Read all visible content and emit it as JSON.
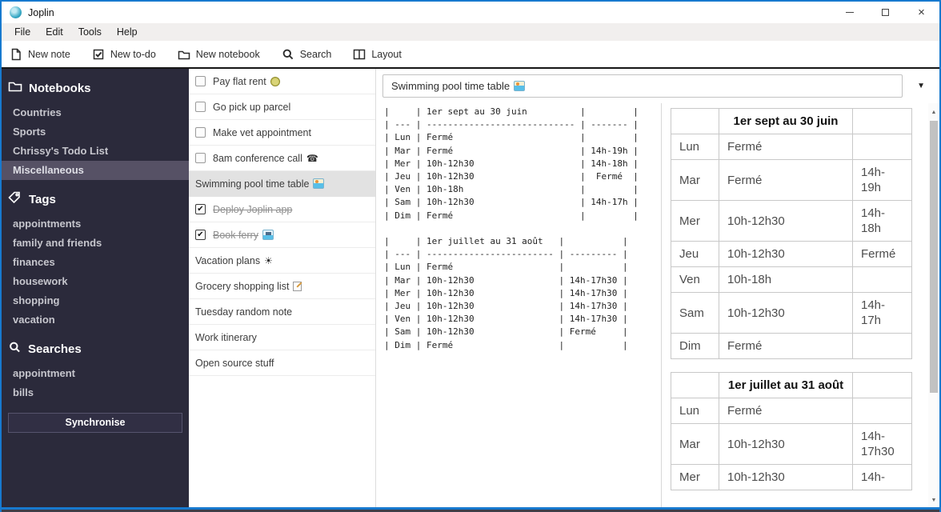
{
  "window": {
    "title": "Joplin",
    "controls": {
      "minimize": "minimize",
      "maximize": "maximize",
      "close": "close"
    }
  },
  "menu_bar": {
    "items": [
      "File",
      "Edit",
      "Tools",
      "Help"
    ]
  },
  "toolbar": {
    "items": [
      {
        "label": "New note",
        "icon": "new-note-icon"
      },
      {
        "label": "New to-do",
        "icon": "new-todo-icon"
      },
      {
        "label": "New notebook",
        "icon": "new-notebook-icon"
      },
      {
        "label": "Search",
        "icon": "search-icon"
      },
      {
        "label": "Layout",
        "icon": "layout-icon"
      }
    ]
  },
  "sidebar": {
    "notebooks": {
      "header": "Notebooks",
      "icon": "notebook-folder-icon",
      "items": [
        {
          "label": "Countries",
          "selected": false
        },
        {
          "label": "Sports",
          "selected": false
        },
        {
          "label": "Chrissy's Todo List",
          "selected": false
        },
        {
          "label": "Miscellaneous",
          "selected": true
        }
      ]
    },
    "tags": {
      "header": "Tags",
      "icon": "tag-icon",
      "items": [
        "appointments",
        "family and friends",
        "finances",
        "housework",
        "shopping",
        "vacation"
      ]
    },
    "searches": {
      "header": "Searches",
      "icon": "search-icon",
      "items": [
        "appointment",
        "bills"
      ]
    },
    "sync_button_label": "Synchronise"
  },
  "note_list": {
    "items": [
      {
        "title": "Pay flat rent",
        "emoji": "money-bag",
        "todo": true,
        "checked": false,
        "selected": false
      },
      {
        "title": "Go pick up parcel",
        "todo": true,
        "checked": false,
        "selected": false
      },
      {
        "title": "Make vet appointment",
        "todo": true,
        "checked": false,
        "selected": false
      },
      {
        "title": "8am conference call",
        "emoji": "phone",
        "todo": true,
        "checked": false,
        "selected": false
      },
      {
        "title": "Swimming pool time table",
        "emoji": "swimmer",
        "todo": false,
        "checked": false,
        "selected": true
      },
      {
        "title": "Deploy Joplin app",
        "todo": true,
        "checked": true,
        "selected": false
      },
      {
        "title": "Book ferry",
        "emoji": "ferry",
        "todo": true,
        "checked": true,
        "selected": false
      },
      {
        "title": "Vacation plans",
        "emoji": "sun",
        "todo": false,
        "checked": false,
        "selected": false
      },
      {
        "title": "Grocery shopping list",
        "emoji": "memo",
        "todo": false,
        "checked": false,
        "selected": false
      },
      {
        "title": "Tuesday random note",
        "todo": false,
        "checked": false,
        "selected": false
      },
      {
        "title": "Work itinerary",
        "todo": false,
        "checked": false,
        "selected": false
      },
      {
        "title": "Open source stuff",
        "todo": false,
        "checked": false,
        "selected": false
      }
    ]
  },
  "editor": {
    "note_title": "Swimming pool time table",
    "note_title_emoji": "swimmer",
    "dropdown_arrow": "▼",
    "lines": [
      "|     | 1er sept au 30 juin          |         |",
      "| --- | ---------------------------- | ------- |",
      "| Lun | Fermé                        |         |",
      "| Mar | Fermé                        | 14h-19h |",
      "| Mer | 10h-12h30                    | 14h-18h |",
      "| Jeu | 10h-12h30                    |  Fermé  |",
      "| Ven | 10h-18h                      |         |",
      "| Sam | 10h-12h30                    | 14h-17h |",
      "| Dim | Fermé                        |         |",
      "",
      "|     | 1er juillet au 31 août   |           |",
      "| --- | ------------------------ | --------- |",
      "| Lun | Fermé                    |           |",
      "| Mar | 10h-12h30                | 14h-17h30 |",
      "| Mer | 10h-12h30                | 14h-17h30 |",
      "| Jeu | 10h-12h30                | 14h-17h30 |",
      "| Ven | 10h-12h30                | 14h-17h30 |",
      "| Sam | 10h-12h30                | Fermé     |",
      "| Dim | Fermé                    |           |"
    ]
  },
  "viewer": {
    "tables": [
      {
        "header": [
          "",
          "1er sept au 30 juin",
          ""
        ],
        "rows": [
          [
            "Lun",
            "Fermé",
            ""
          ],
          [
            "Mar",
            "Fermé",
            "14h-19h"
          ],
          [
            "Mer",
            "10h-12h30",
            "14h-18h"
          ],
          [
            "Jeu",
            "10h-12h30",
            "Fermé"
          ],
          [
            "Ven",
            "10h-18h",
            ""
          ],
          [
            "Sam",
            "10h-12h30",
            "14h-17h"
          ],
          [
            "Dim",
            "Fermé",
            ""
          ]
        ]
      },
      {
        "header": [
          "",
          "1er juillet au 31 août",
          ""
        ],
        "rows": [
          [
            "Lun",
            "Fermé",
            ""
          ],
          [
            "Mar",
            "10h-12h30",
            "14h-17h30"
          ],
          [
            "Mer",
            "10h-12h30",
            "14h-"
          ]
        ]
      }
    ]
  },
  "colors": {
    "sidebar_bg": "#2b2a3b",
    "sidebar_selected_bg": "#565165",
    "note_selected_bg": "#e2e2e2",
    "window_border": "#1779cf"
  }
}
